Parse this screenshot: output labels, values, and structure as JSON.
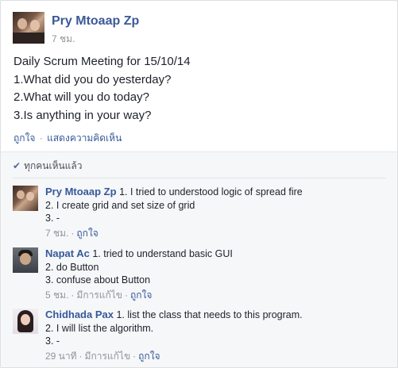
{
  "post": {
    "author": "Pry Mtoaap Zp",
    "time": "7 ชม.",
    "lines": [
      "Daily Scrum Meeting for 15/10/14",
      "1.What did you do yesterday?",
      "2.What will you do today?",
      "3.Is anything in your way?"
    ],
    "actions": {
      "like": "ถูกใจ",
      "sep": "·",
      "comment": "แสดงความคิดเห็น"
    }
  },
  "seen": {
    "icon": "check-icon",
    "label": "ทุกคนเห็นแล้ว"
  },
  "comments": [
    {
      "author": "Pry Mtoaap Zp",
      "first_line": "1. I tried to understood logic of spread fire",
      "lines": [
        "2. I create grid and set size of grid",
        "3. -"
      ],
      "time": "7 ชม.",
      "edited": "",
      "like": "ถูกใจ"
    },
    {
      "author": "Napat Ac",
      "first_line": "1. tried to understand basic GUI",
      "lines": [
        "2. do Button",
        "3. confuse about Button"
      ],
      "time": "5 ชม.",
      "edited": "มีการแก้ไข",
      "like": "ถูกใจ"
    },
    {
      "author": "Chidhada Pax",
      "first_line": "1. list the class that needs to this program.",
      "lines": [
        "2. I will list the algorithm.",
        "3. -"
      ],
      "time": "29 นาที",
      "edited": "มีการแก้ไข",
      "like": "ถูกใจ"
    }
  ],
  "colors": {
    "link": "#365899",
    "name": "#3b5998",
    "meta": "#90949c",
    "seen_bg": "#f6f7f9"
  }
}
